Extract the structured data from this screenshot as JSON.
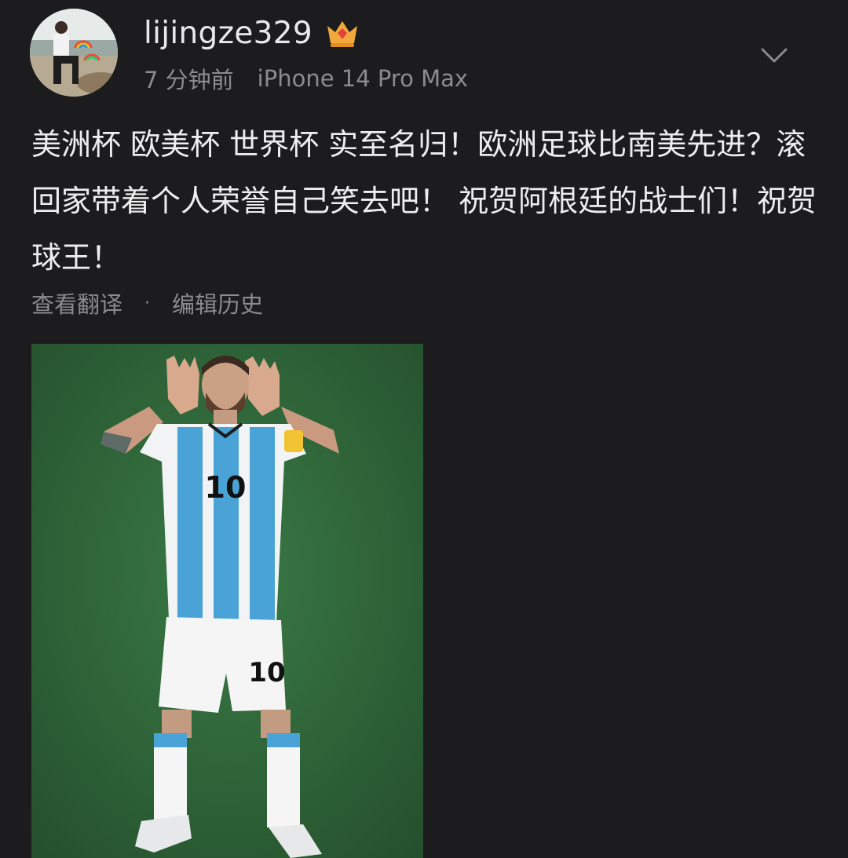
{
  "post": {
    "username": "lijingze329",
    "time": "7 分钟前",
    "device": "iPhone 14 Pro Max",
    "content": "美洲杯 欧美杯 世界杯 实至名归！欧洲足球比南美先进？滚回家带着个人荣誉自己笑去吧！ 祝贺阿根廷的战士们！祝贺球王！",
    "translate_label": "查看翻译",
    "separator": "·",
    "edit_history_label": "编辑历史",
    "jersey_number": "10",
    "shorts_number": "10"
  },
  "icons": {
    "badge": "crown-icon",
    "menu": "chevron-down-icon"
  },
  "colors": {
    "background": "#1c1c1e",
    "text_primary": "#eeeeef",
    "text_secondary": "#8c8c8f",
    "badge": "#f2a93b",
    "field_green": "#2b5d35",
    "jersey_blue": "#4aa3d6"
  }
}
